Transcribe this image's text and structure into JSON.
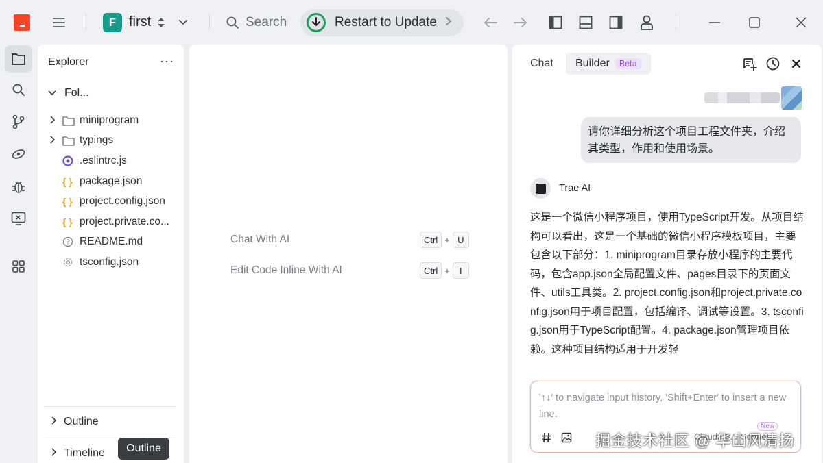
{
  "titlebar": {
    "workspace_initial": "F",
    "workspace_name": "first",
    "search_label": "Search",
    "update_label": "Restart to Update"
  },
  "explorer": {
    "title": "Explorer",
    "more": "···",
    "folder": "Fol...",
    "items": [
      {
        "label": "miniprogram",
        "kind": "folder"
      },
      {
        "label": "typings",
        "kind": "folder"
      },
      {
        "label": ".eslintrc.js",
        "kind": "eslint"
      },
      {
        "label": "package.json",
        "kind": "json"
      },
      {
        "label": "project.config.json",
        "kind": "json"
      },
      {
        "label": "project.private.co...",
        "kind": "json"
      },
      {
        "label": "README.md",
        "kind": "readme"
      },
      {
        "label": "tsconfig.json",
        "kind": "config"
      }
    ],
    "outline": "Outline",
    "timeline": "Timeline",
    "tooltip": "Outline"
  },
  "editor": {
    "hint_chat": "Chat With AI",
    "hint_inline": "Edit Code Inline With AI",
    "key_ctrl": "Ctrl",
    "key_plus": "+",
    "key_u": "U",
    "key_i": "I"
  },
  "ai_panel": {
    "tab_chat": "Chat",
    "tab_builder": "Builder",
    "beta": "Beta",
    "user_message": "请你详细分析这个项目工程文件夹，介绍其类型，作用和使用场景。",
    "ai_name": "Trae AI",
    "ai_message": "这是一个微信小程序项目，使用TypeScript开发。从项目结构可以看出，这是一个基础的微信小程序模板项目，主要包含以下部分：1. miniprogram目录存放小程序的主要代码，包含app.json全局配置文件、pages目录下的页面文件、utils工具类。2. project.config.json和project.private.config.json用于项目配置，包括编译、调试等设置。3. tsconfig.json用于TypeScript配置。4. package.json管理项目依赖。这种项目结构适用于开发轻",
    "input_placeholder": "'↑↓' to navigate input history, 'Shift+Enter' to insert a new line.",
    "new_badge": "New",
    "model_label": "Claude-3.5-Sonnet"
  },
  "watermark": "掘金技术社区 @ 华山风清扬",
  "colors": {
    "accent_logo": "#f4452b",
    "workspace_badge": "#179c8b",
    "update_icon": "#1f9d5a",
    "beta_text": "#9a55d6",
    "json_icon": "#e0a21b",
    "eslint_icon": "#6b4fd8"
  }
}
